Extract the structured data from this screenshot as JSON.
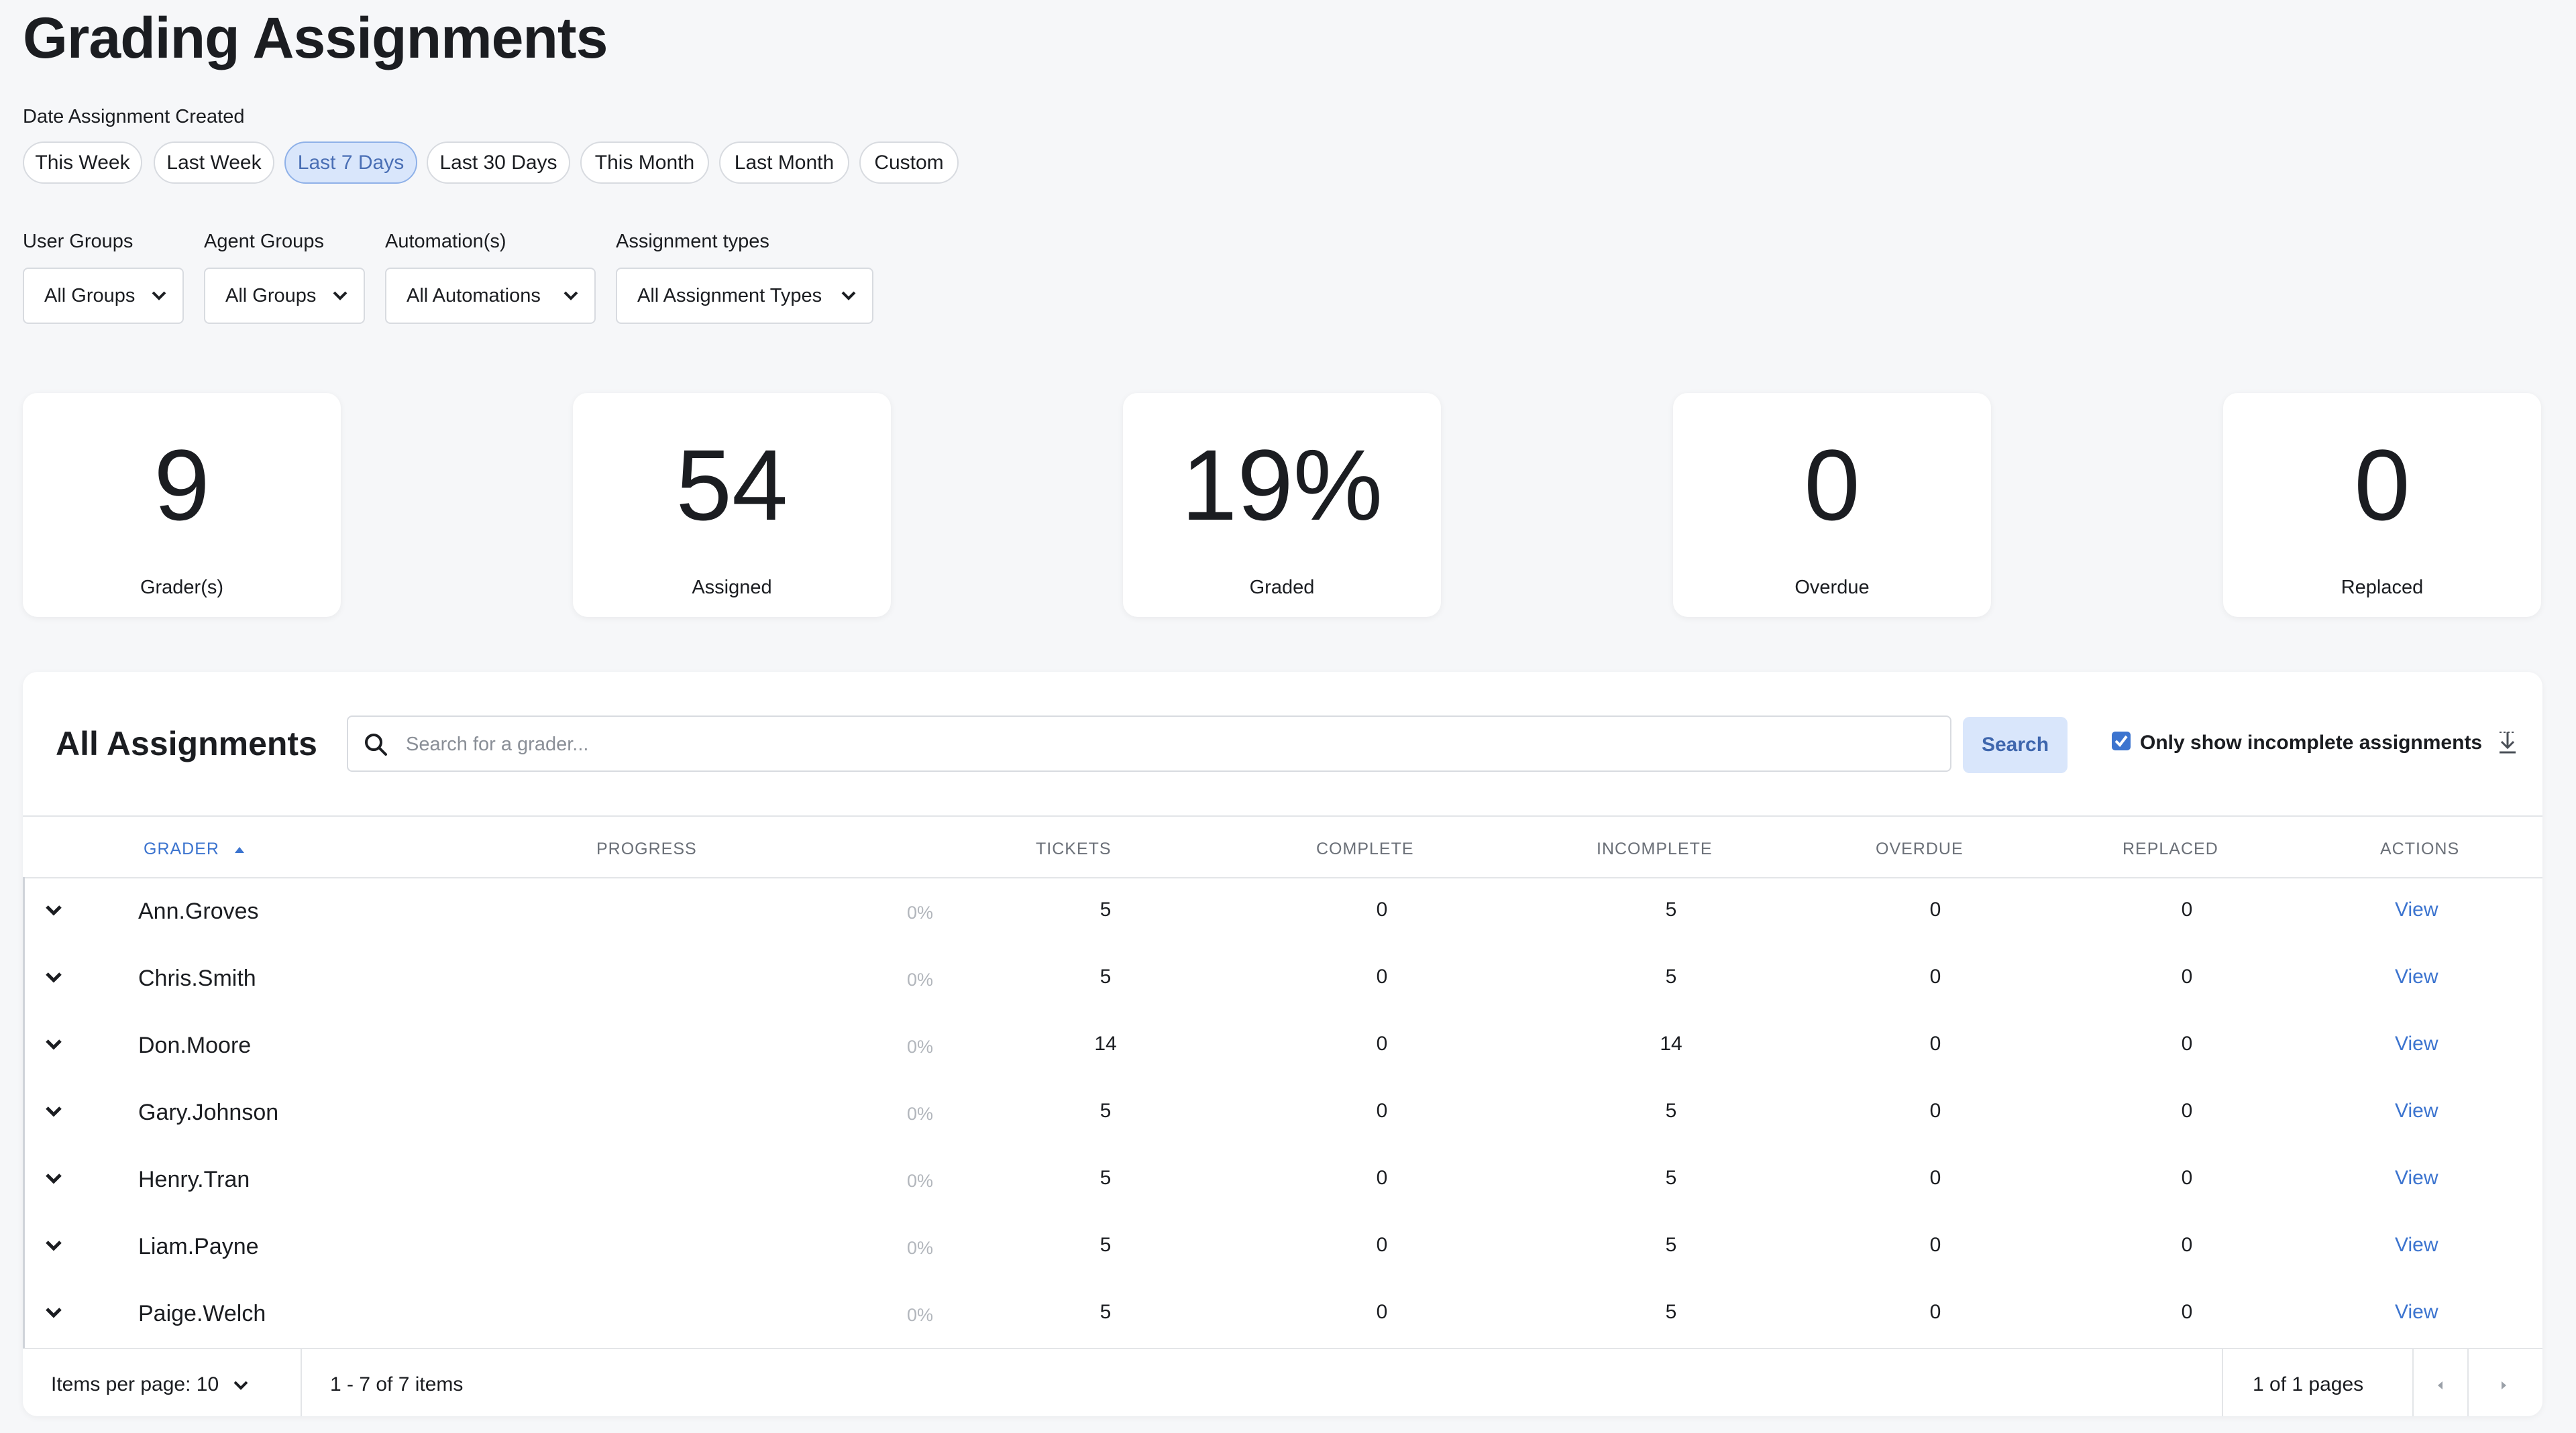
{
  "page": {
    "title": "Grading Assignments"
  },
  "date_filter": {
    "label": "Date Assignment Created",
    "chips": [
      "This Week",
      "Last Week",
      "Last 7 Days",
      "Last 30 Days",
      "This Month",
      "Last Month",
      "Custom"
    ],
    "selected": "Last 7 Days"
  },
  "filters": {
    "user_groups": {
      "label": "User Groups",
      "value": "All Groups"
    },
    "agent_groups": {
      "label": "Agent Groups",
      "value": "All Groups"
    },
    "automations": {
      "label": "Automation(s)",
      "value": "All Automations"
    },
    "assignment_types": {
      "label": "Assignment types",
      "value": "All Assignment Types"
    }
  },
  "stats": [
    {
      "value": "9",
      "label": "Grader(s)"
    },
    {
      "value": "54",
      "label": "Assigned"
    },
    {
      "value": "19%",
      "label": "Graded"
    },
    {
      "value": "0",
      "label": "Overdue"
    },
    {
      "value": "0",
      "label": "Replaced"
    }
  ],
  "assignments": {
    "title": "All Assignments",
    "search_placeholder": "Search for a grader...",
    "search_button": "Search",
    "only_incomplete_label": "Only show incomplete assignments",
    "only_incomplete_checked": true,
    "columns": {
      "grader": "GRADER",
      "progress": "PROGRESS",
      "tickets": "TICKETS",
      "complete": "COMPLETE",
      "incomplete": "INCOMPLETE",
      "overdue": "OVERDUE",
      "replaced": "REPLACED",
      "actions": "ACTIONS"
    },
    "rows": [
      {
        "grader": "Ann.Groves",
        "progress": "0%",
        "tickets": "5",
        "complete": "0",
        "incomplete": "5",
        "overdue": "0",
        "replaced": "0",
        "action": "View"
      },
      {
        "grader": "Chris.Smith",
        "progress": "0%",
        "tickets": "5",
        "complete": "0",
        "incomplete": "5",
        "overdue": "0",
        "replaced": "0",
        "action": "View"
      },
      {
        "grader": "Don.Moore",
        "progress": "0%",
        "tickets": "14",
        "complete": "0",
        "incomplete": "14",
        "overdue": "0",
        "replaced": "0",
        "action": "View"
      },
      {
        "grader": "Gary.Johnson",
        "progress": "0%",
        "tickets": "5",
        "complete": "0",
        "incomplete": "5",
        "overdue": "0",
        "replaced": "0",
        "action": "View"
      },
      {
        "grader": "Henry.Tran",
        "progress": "0%",
        "tickets": "5",
        "complete": "0",
        "incomplete": "5",
        "overdue": "0",
        "replaced": "0",
        "action": "View"
      },
      {
        "grader": "Liam.Payne",
        "progress": "0%",
        "tickets": "5",
        "complete": "0",
        "incomplete": "5",
        "overdue": "0",
        "replaced": "0",
        "action": "View"
      },
      {
        "grader": "Paige.Welch",
        "progress": "0%",
        "tickets": "5",
        "complete": "0",
        "incomplete": "5",
        "overdue": "0",
        "replaced": "0",
        "action": "View"
      }
    ],
    "footer": {
      "items_per_page": "Items per page: 10",
      "range": "1 - 7 of 7 items",
      "pages": "1 of 1 pages"
    }
  },
  "colors": {
    "accent": "#3c74cf",
    "chip_active_bg": "#d9e6fb"
  },
  "icons": [
    "search-icon",
    "chevron-down-icon",
    "sort-asc-icon",
    "checkbox-check-icon",
    "download-icon",
    "prev-page-icon",
    "next-page-icon"
  ]
}
